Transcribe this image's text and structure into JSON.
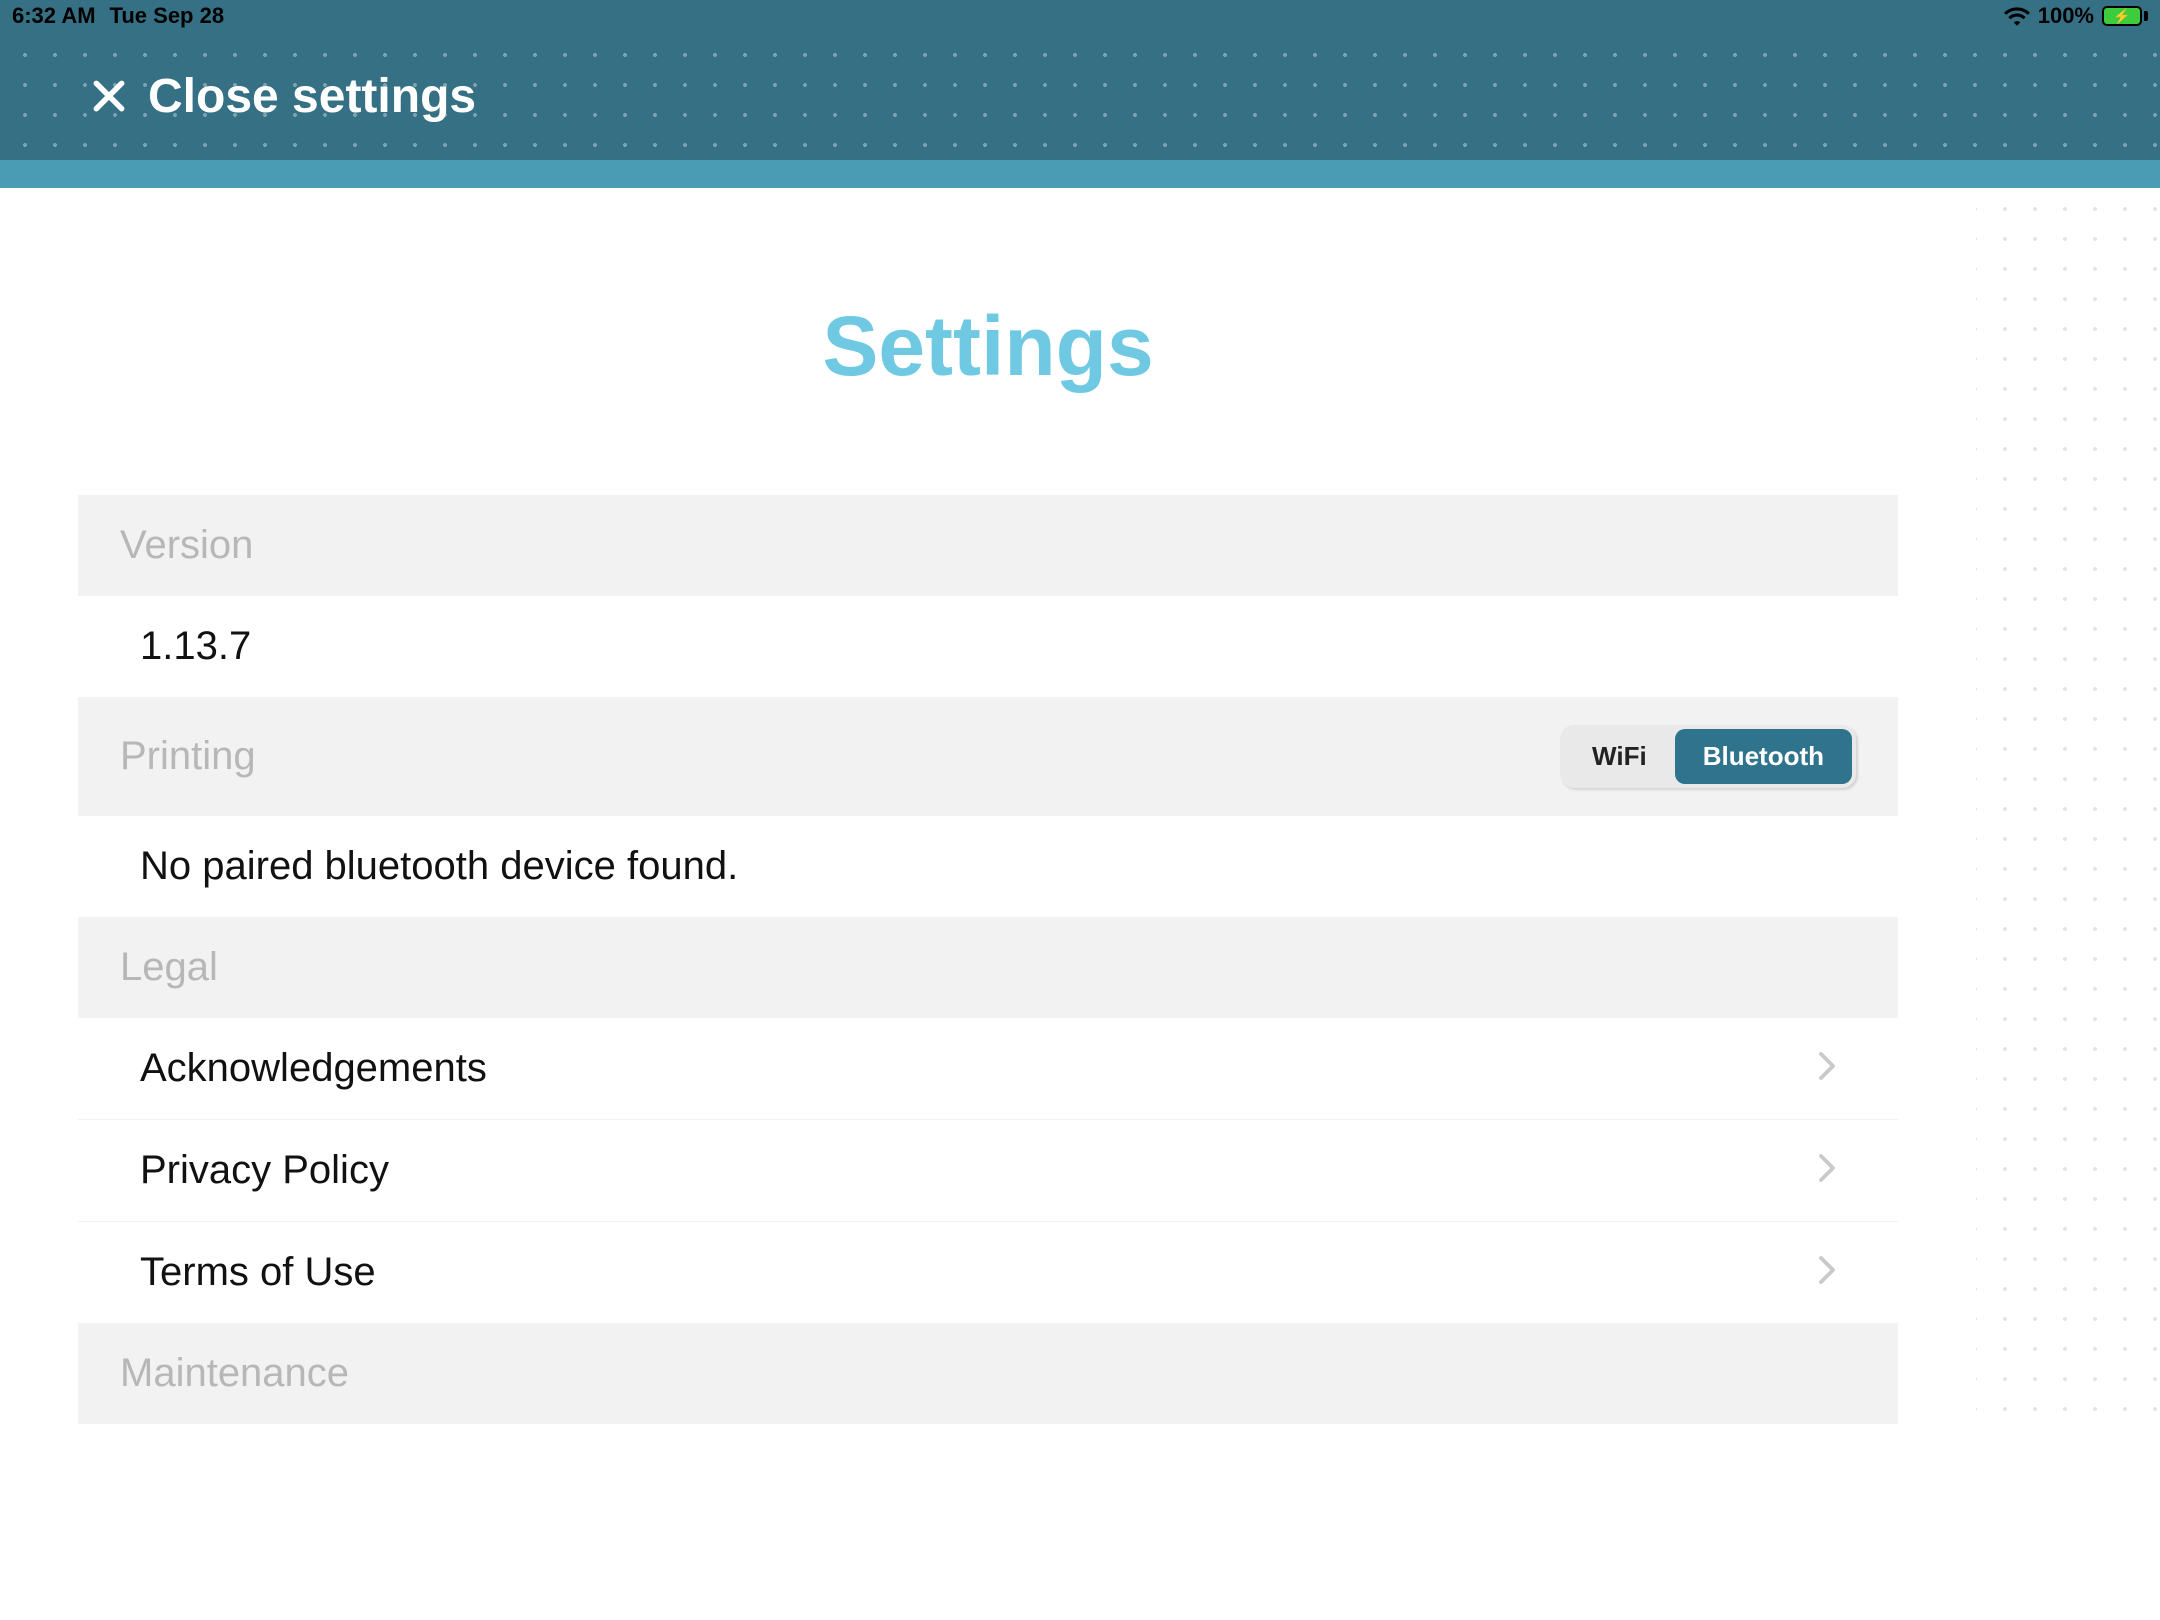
{
  "status": {
    "time": "6:32 AM",
    "date": "Tue Sep 28",
    "battery_pct": "100%"
  },
  "header": {
    "close_label": "Close settings"
  },
  "page": {
    "title": "Settings"
  },
  "sections": {
    "version": {
      "header": "Version",
      "value": "1.13.7"
    },
    "printing": {
      "header": "Printing",
      "segments": {
        "wifi": "WiFi",
        "bluetooth": "Bluetooth"
      },
      "selected": "bluetooth",
      "status_text": "No paired bluetooth device found."
    },
    "legal": {
      "header": "Legal",
      "items": [
        {
          "label": "Acknowledgements"
        },
        {
          "label": "Privacy Policy"
        },
        {
          "label": "Terms of Use"
        }
      ]
    },
    "maintenance": {
      "header": "Maintenance"
    }
  }
}
